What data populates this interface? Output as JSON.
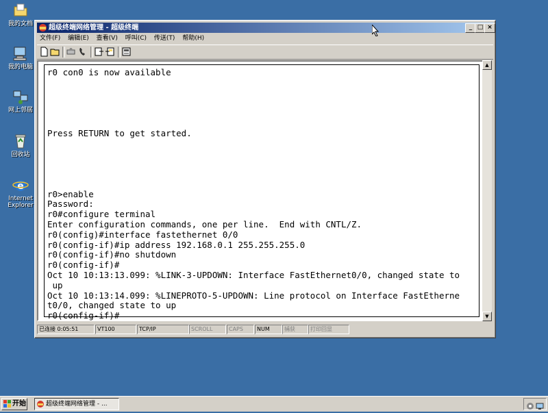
{
  "desktop": {
    "icons": [
      {
        "label": "我的文档",
        "icon": "folder-documents-icon"
      },
      {
        "label": "我的电脑",
        "icon": "computer-icon"
      },
      {
        "label": "网上邻居",
        "icon": "network-icon"
      },
      {
        "label": "回收站",
        "icon": "recycle-bin-icon"
      },
      {
        "label": "Internet Explorer",
        "icon": "internet-explorer-icon"
      }
    ]
  },
  "window": {
    "title": "超级终端网络管理 - 超级终端",
    "controls": {
      "minimize": "_",
      "restore": "□",
      "close": "×"
    },
    "menu": [
      "文件(F)",
      "编辑(E)",
      "查看(V)",
      "呼叫(C)",
      "传送(T)",
      "帮助(H)"
    ],
    "toolbar": [
      "new-file-icon",
      "open-file-icon",
      "disconnect-icon",
      "call-icon",
      "send-icon",
      "receive-icon",
      "properties-icon"
    ]
  },
  "terminal": {
    "text": "r0 con0 is now available\n\n\n\n\n\nPress RETURN to get started.\n\n\n\n\n\nr0>enable\nPassword:\nr0#configure terminal\nEnter configuration commands, one per line.  End with CNTL/Z.\nr0(config)#interface fastethernet 0/0\nr0(config-if)#ip address 192.168.0.1 255.255.255.0\nr0(config-if)#no shutdown\nr0(config-if)#\nOct 10 10:13:13.099: %LINK-3-UPDOWN: Interface FastEthernet0/0, changed state to\n up\nOct 10 10:13:14.099: %LINEPROTO-5-UPDOWN: Line protocol on Interface FastEtherne\nt0/0, changed state to up\nr0(config-if)#"
  },
  "status": {
    "connected": "已连接 0:05:51",
    "emulation": "VT100",
    "protocol": "TCP/IP",
    "scroll": "SCROLL",
    "caps": "CAPS",
    "num": "NUM",
    "capture": "捕获",
    "print_echo": "打印回显"
  },
  "taskbar": {
    "start": "开始",
    "task": "超级终端网络管理 - ..."
  },
  "colors": {
    "desktop": "#3a6ea5",
    "titlebar_start": "#0a246a",
    "titlebar_end": "#a6caf0",
    "face": "#d4d0c8"
  }
}
